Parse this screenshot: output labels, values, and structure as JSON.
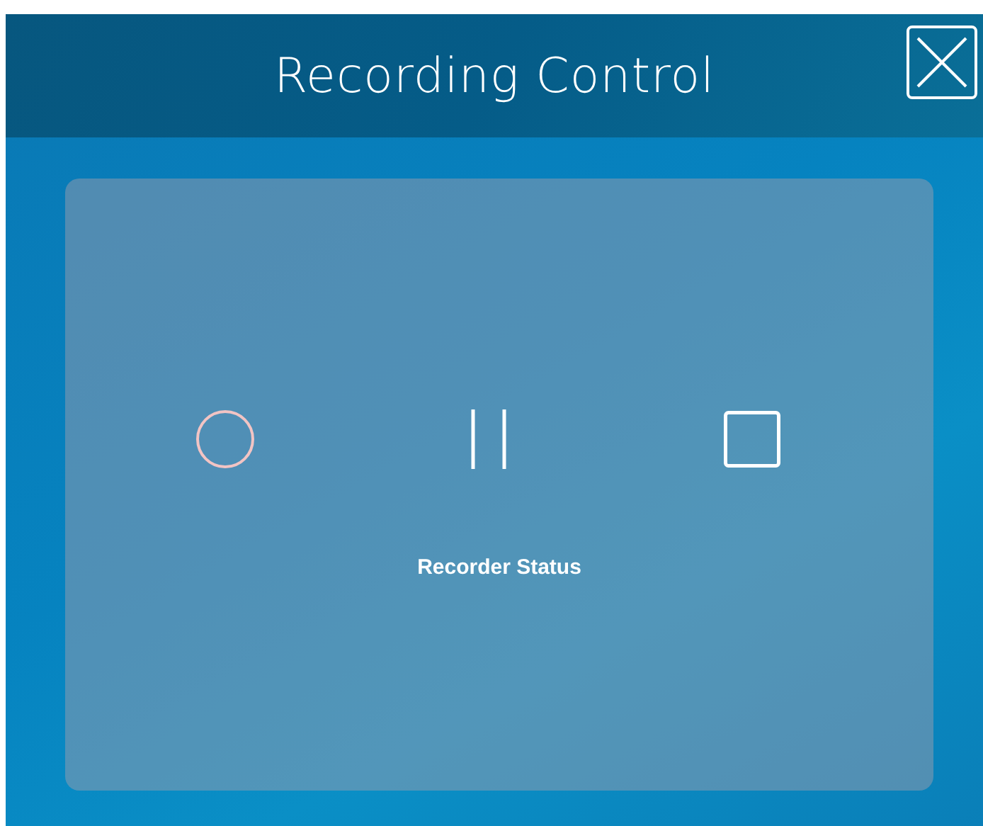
{
  "window": {
    "title": "Recording Control"
  },
  "controls": [
    {
      "kind": "record"
    },
    {
      "kind": "pause"
    },
    {
      "kind": "stop"
    }
  ],
  "status": "Recorder Status"
}
